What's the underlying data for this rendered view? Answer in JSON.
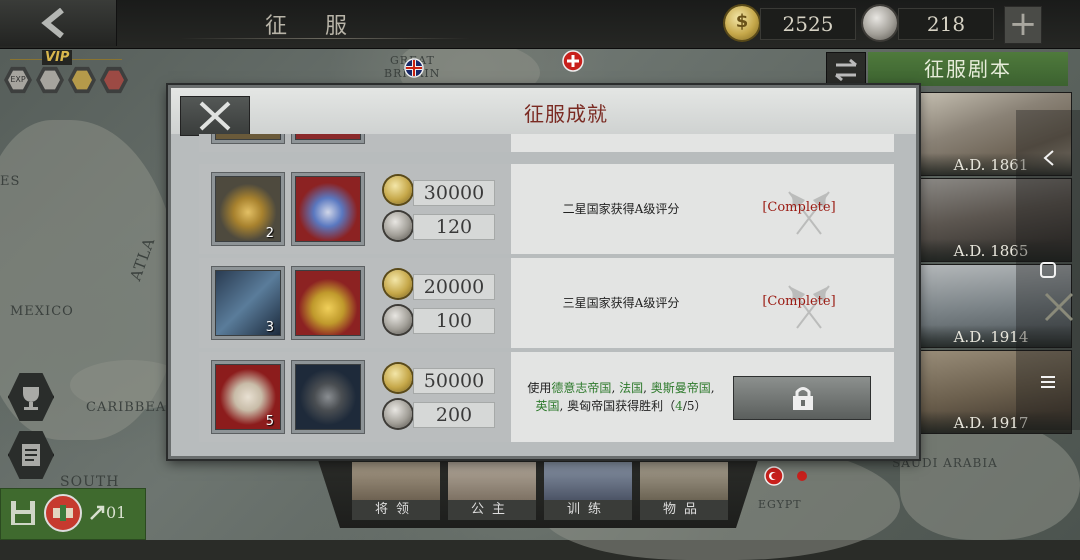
{
  "header": {
    "title": "征服",
    "gold_amount": "2525",
    "medal_amount": "218",
    "plus_label": "+"
  },
  "vip": {
    "label": "VIP",
    "badges": [
      "EXP",
      "",
      "",
      ""
    ]
  },
  "map": {
    "labels": [
      "GREAT",
      "BRITAIN",
      "ES",
      "MEXICO",
      "ATLA",
      "CARIBBEAN",
      "SOUTH",
      "SAUDI ARABIA",
      "EGYPT"
    ]
  },
  "save_panel": {
    "label": "01"
  },
  "scenario_panel": {
    "title": "征服剧本",
    "cards": [
      {
        "year": "A.D. 1861"
      },
      {
        "year": "A.D. 1865"
      },
      {
        "year": "A.D. 1914"
      },
      {
        "year": "A.D. 1917"
      }
    ]
  },
  "bottom_nav": {
    "items": [
      {
        "label": "将领"
      },
      {
        "label": "公主"
      },
      {
        "label": "训练"
      },
      {
        "label": "物品"
      }
    ]
  },
  "dialog": {
    "title": "征服成就",
    "rows": [
      {
        "item1_count": "2",
        "gold_reward": "30000",
        "medal_reward": "120",
        "description": "二星国家获得A级评分",
        "status": "[Complete]"
      },
      {
        "item1_count": "3",
        "gold_reward": "20000",
        "medal_reward": "100",
        "description": "三星国家获得A级评分",
        "status": "[Complete]"
      },
      {
        "item1_count": "5",
        "gold_reward": "50000",
        "medal_reward": "200",
        "desc_prefix": "使用",
        "desc_nations": [
          "德意志帝国",
          "法国",
          "奥斯曼帝国",
          "英国",
          "奥匈帝国"
        ],
        "desc_suffix": "获得胜利",
        "progress_current": "4",
        "progress_total": "5"
      }
    ]
  },
  "colors": {
    "accent_green": "#3c6230",
    "complete_red": "#9a1a12",
    "nation_green": "#2e7a2c",
    "title_red": "#7a2a22"
  }
}
